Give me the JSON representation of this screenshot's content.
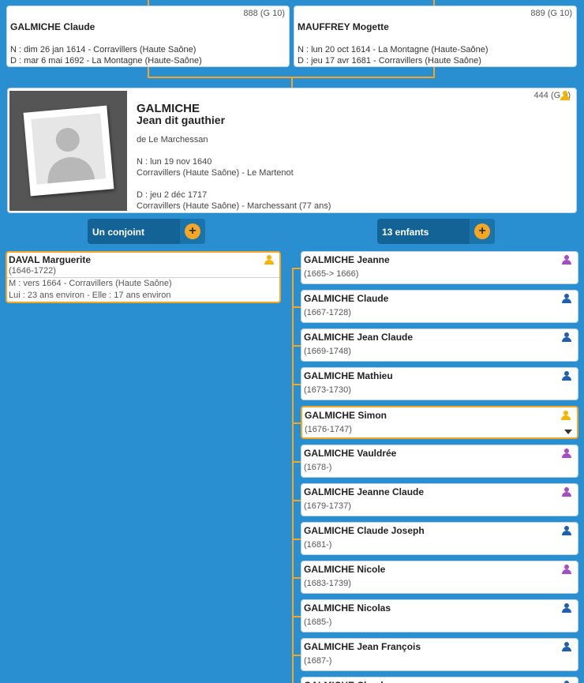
{
  "father": {
    "name": "GALMICHE Claude",
    "sosa": "888 (G 10)",
    "birth": "N : dim 26 jan 1614 - Corravillers (Haute Saône)",
    "death": "D : mar 6 mai 1692 - La Montagne (Haute-Saône)"
  },
  "mother": {
    "name": "MAUFFREY Mogette",
    "sosa": "889 (G 10)",
    "birth": "N : lun 20 oct 1614 - La Montagne (Haute-Saône)",
    "death": "D : jeu 17 avr 1681 - Corravillers (Haute Saône)"
  },
  "main": {
    "surname": "GALMICHE",
    "given": "Jean dit gauthier",
    "sosa": "444 (G 9)",
    "origin": "de Le Marchessan",
    "birth_date": "N : lun 19 nov 1640",
    "birth_place": "Corravillers (Haute Saône) - Le Martenot",
    "death_date": "D : jeu 2 déc 1717",
    "death_place": "Corravillers (Haute Saône) - Marchessant (77 ans)"
  },
  "buttons": {
    "spouses_label": "Un conjoint",
    "children_label": "13 enfants",
    "plus": "+"
  },
  "spouse": {
    "name": "DAVAL Marguerite",
    "dates": "(1646-1722)",
    "marriage": "M : vers 1664 - Corravillers (Haute Saône)",
    "ages": "Lui : 23 ans environ - Elle : 17 ans environ"
  },
  "children": [
    {
      "name": "GALMICHE Jeanne",
      "dates": "(1665-> 1666)",
      "sex": "female"
    },
    {
      "name": "GALMICHE Claude",
      "dates": "(1667-1728)",
      "sex": "male"
    },
    {
      "name": "GALMICHE Jean Claude",
      "dates": "(1669-1748)",
      "sex": "male"
    },
    {
      "name": "GALMICHE Mathieu",
      "dates": "(1673-1730)",
      "sex": "male"
    },
    {
      "name": "GALMICHE Simon",
      "dates": "(1676-1747)",
      "sex": "self"
    },
    {
      "name": "GALMICHE Vauldrée",
      "dates": "(1678-)",
      "sex": "female"
    },
    {
      "name": "GALMICHE Jeanne Claude",
      "dates": "(1679-1737)",
      "sex": "female"
    },
    {
      "name": "GALMICHE Claude Joseph",
      "dates": "(1681-)",
      "sex": "male"
    },
    {
      "name": "GALMICHE Nicole",
      "dates": "(1683-1739)",
      "sex": "female"
    },
    {
      "name": "GALMICHE Nicolas",
      "dates": "(1685-)",
      "sex": "male"
    },
    {
      "name": "GALMICHE Jean François",
      "dates": "(1687-)",
      "sex": "male"
    },
    {
      "name": "GALMICHE Claude",
      "dates": "",
      "sex": "male"
    }
  ],
  "colors": {
    "background": "#2a8fd0",
    "accent": "#f5a623",
    "button": "#136396",
    "male": "#1e5fb0",
    "female": "#a54cc6",
    "sosa_person": "#f5b400"
  },
  "icons": {
    "add": "plus-circle-icon",
    "male": "person-male-icon",
    "female": "person-female-icon",
    "ancestor": "person-ancestor-icon",
    "expand": "chevron-down-icon",
    "photo": "placeholder-silhouette"
  }
}
